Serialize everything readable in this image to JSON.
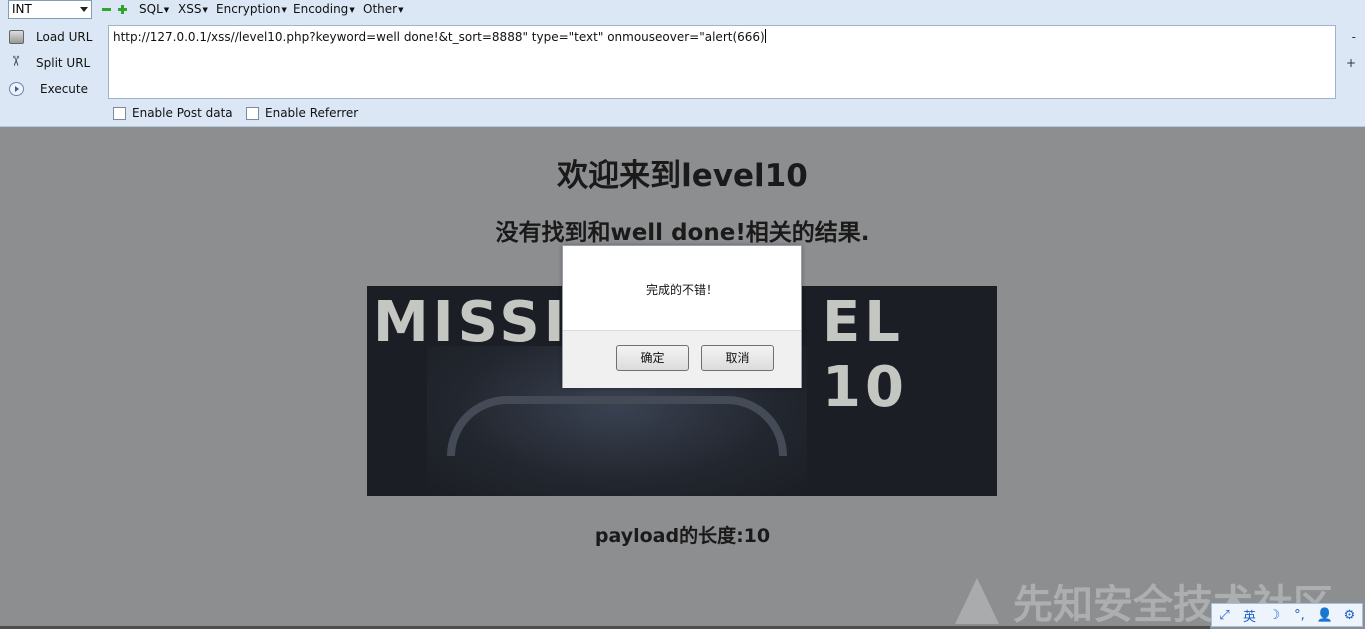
{
  "hackbar": {
    "select_value": "INT",
    "menus": [
      "SQL",
      "XSS",
      "Encryption",
      "Encoding",
      "Other"
    ],
    "buttons": {
      "load": "Load URL",
      "split": "Split URL",
      "execute": "Execute"
    },
    "url": "http://127.0.0.1/xss//level10.php?keyword=well done!&t_sort=8888\" type=\"text\" onmouseover=\"alert(666)",
    "side_top": "-",
    "side_bottom": "+",
    "enable_post": "Enable Post data",
    "enable_referrer": "Enable Referrer"
  },
  "page": {
    "title": "欢迎来到level10",
    "result": "没有找到和well done!相关的结果.",
    "banner_left": "MISSI",
    "banner_right": "EL 10",
    "payload_length": "payload的长度:10"
  },
  "dialog": {
    "message": "完成的不错！",
    "ok": "确定",
    "cancel": "取消"
  },
  "watermark": "先知安全技术社区",
  "ime": [
    "英",
    "☽",
    "°,",
    "👤",
    "⚙"
  ]
}
